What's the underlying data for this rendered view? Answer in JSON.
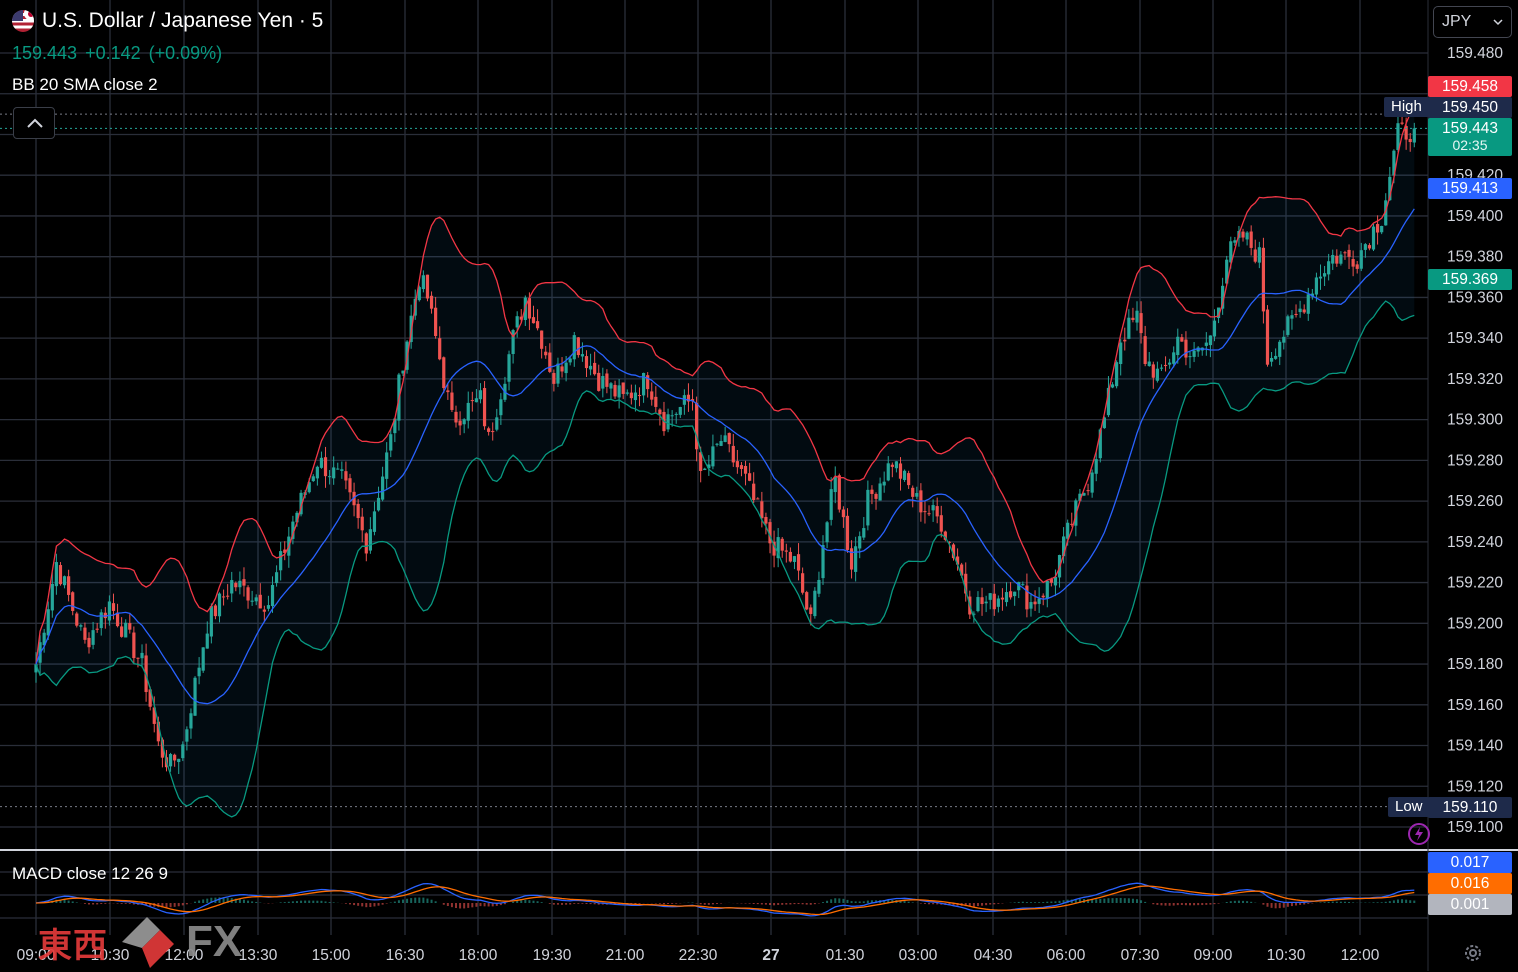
{
  "header": {
    "title": "U.S. Dollar / Japanese Yen · 5",
    "last_price": "159.443",
    "change": "+0.142",
    "change_pct": "(+0.09%)",
    "bb_legend": "BB 20 SMA close 2",
    "macd_legend": "MACD close 12 26 9",
    "currency": "JPY"
  },
  "price_scale": {
    "labels": [
      "159.480",
      "159.460",
      "159.440",
      "159.420",
      "159.400",
      "159.380",
      "159.360",
      "159.340",
      "159.320",
      "159.300",
      "159.280",
      "159.260",
      "159.240",
      "159.220",
      "159.200",
      "159.180",
      "159.160",
      "159.140",
      "159.120",
      "159.100"
    ],
    "badges": {
      "bb_upper": "159.458",
      "high_tag": "High",
      "high": "159.450",
      "last": "159.443",
      "countdown": "02:35",
      "bb_basis": "159.413",
      "bb_lower": "159.369",
      "low_tag": "Low",
      "low": "159.110"
    },
    "macd_badges": {
      "macd": "0.017",
      "signal": "0.016",
      "hist": "0.001"
    }
  },
  "time_axis": [
    "09:00",
    "10:30",
    "12:00",
    "13:30",
    "15:00",
    "16:30",
    "18:00",
    "19:30",
    "21:00",
    "22:30",
    "27",
    "01:30",
    "03:00",
    "04:30",
    "06:00",
    "07:30",
    "09:00",
    "10:30",
    "12:00"
  ],
  "watermark": {
    "cjk": "東西",
    "fx": "FX"
  },
  "colors": {
    "up": "#26a69a",
    "down": "#ef5350",
    "upper_band": "#f23645",
    "basis": "#2962ff",
    "lower_band": "#089981",
    "macd": "#2962ff",
    "signal": "#ff6d00",
    "last_badge": "#089981"
  },
  "chart_data": {
    "type": "candlestick",
    "title": "U.S. Dollar / Japanese Yen · 5",
    "y_range": [
      159.09,
      159.49
    ],
    "x_range": [
      "26 09:00",
      "27 13:10"
    ],
    "close_anchors": [
      [
        "09:00",
        159.18
      ],
      [
        "09:25",
        159.23
      ],
      [
        "10:00",
        159.19
      ],
      [
        "10:30",
        159.21
      ],
      [
        "11:10",
        159.18
      ],
      [
        "11:30",
        159.14
      ],
      [
        "11:45",
        159.13
      ],
      [
        "12:00",
        159.14
      ],
      [
        "12:30",
        159.2
      ],
      [
        "13:00",
        159.22
      ],
      [
        "13:45",
        159.21
      ],
      [
        "14:15",
        159.25
      ],
      [
        "14:45",
        159.28
      ],
      [
        "15:15",
        159.27
      ],
      [
        "15:45",
        159.24
      ],
      [
        "16:15",
        159.29
      ],
      [
        "16:30",
        159.33
      ],
      [
        "16:50",
        159.37
      ],
      [
        "17:00",
        159.36
      ],
      [
        "17:30",
        159.3
      ],
      [
        "18:05",
        159.31
      ],
      [
        "18:15",
        159.29
      ],
      [
        "18:45",
        159.34
      ],
      [
        "19:00",
        159.36
      ],
      [
        "19:20",
        159.34
      ],
      [
        "19:35",
        159.32
      ],
      [
        "20:00",
        159.34
      ],
      [
        "20:30",
        159.32
      ],
      [
        "21:00",
        159.31
      ],
      [
        "21:30",
        159.32
      ],
      [
        "21:50",
        159.3
      ],
      [
        "22:25",
        159.31
      ],
      [
        "22:35",
        159.27
      ],
      [
        "23:00",
        159.29
      ],
      [
        "23:30",
        159.27
      ],
      [
        "00:00",
        159.24
      ],
      [
        "00:30",
        159.23
      ],
      [
        "00:50",
        159.2
      ],
      [
        "01:05",
        159.24
      ],
      [
        "01:20",
        159.27
      ],
      [
        "01:40",
        159.23
      ],
      [
        "02:00",
        159.26
      ],
      [
        "02:30",
        159.28
      ],
      [
        "03:00",
        159.26
      ],
      [
        "03:30",
        159.25
      ],
      [
        "03:50",
        159.23
      ],
      [
        "04:05",
        159.21
      ],
      [
        "04:30",
        159.21
      ],
      [
        "05:00",
        159.22
      ],
      [
        "05:20",
        159.21
      ],
      [
        "05:45",
        159.22
      ],
      [
        "06:10",
        159.25
      ],
      [
        "06:30",
        159.27
      ],
      [
        "06:50",
        159.3
      ],
      [
        "07:10",
        159.34
      ],
      [
        "07:30",
        159.35
      ],
      [
        "07:40",
        159.33
      ],
      [
        "08:00",
        159.32
      ],
      [
        "08:20",
        159.34
      ],
      [
        "08:40",
        159.33
      ],
      [
        "09:00",
        159.34
      ],
      [
        "09:20",
        159.38
      ],
      [
        "09:40",
        159.39
      ],
      [
        "10:00",
        159.38
      ],
      [
        "10:10",
        159.33
      ],
      [
        "10:25",
        159.34
      ],
      [
        "10:45",
        159.35
      ],
      [
        "11:10",
        159.37
      ],
      [
        "11:30",
        159.38
      ],
      [
        "12:00",
        159.38
      ],
      [
        "12:30",
        159.4
      ],
      [
        "12:50",
        159.44
      ],
      [
        "13:10",
        159.443
      ]
    ],
    "series": [
      {
        "name": "BB 20 SMA close 2",
        "last_upper": 159.458,
        "last_basis": 159.413,
        "last_lower": 159.369
      },
      {
        "name": "MACD close 12 26 9",
        "macd": 0.017,
        "signal": 0.016,
        "histogram": 0.001
      }
    ],
    "high": 159.45,
    "low": 159.11,
    "last": 159.443,
    "change": 0.142,
    "change_pct": 0.09,
    "grid": true
  }
}
